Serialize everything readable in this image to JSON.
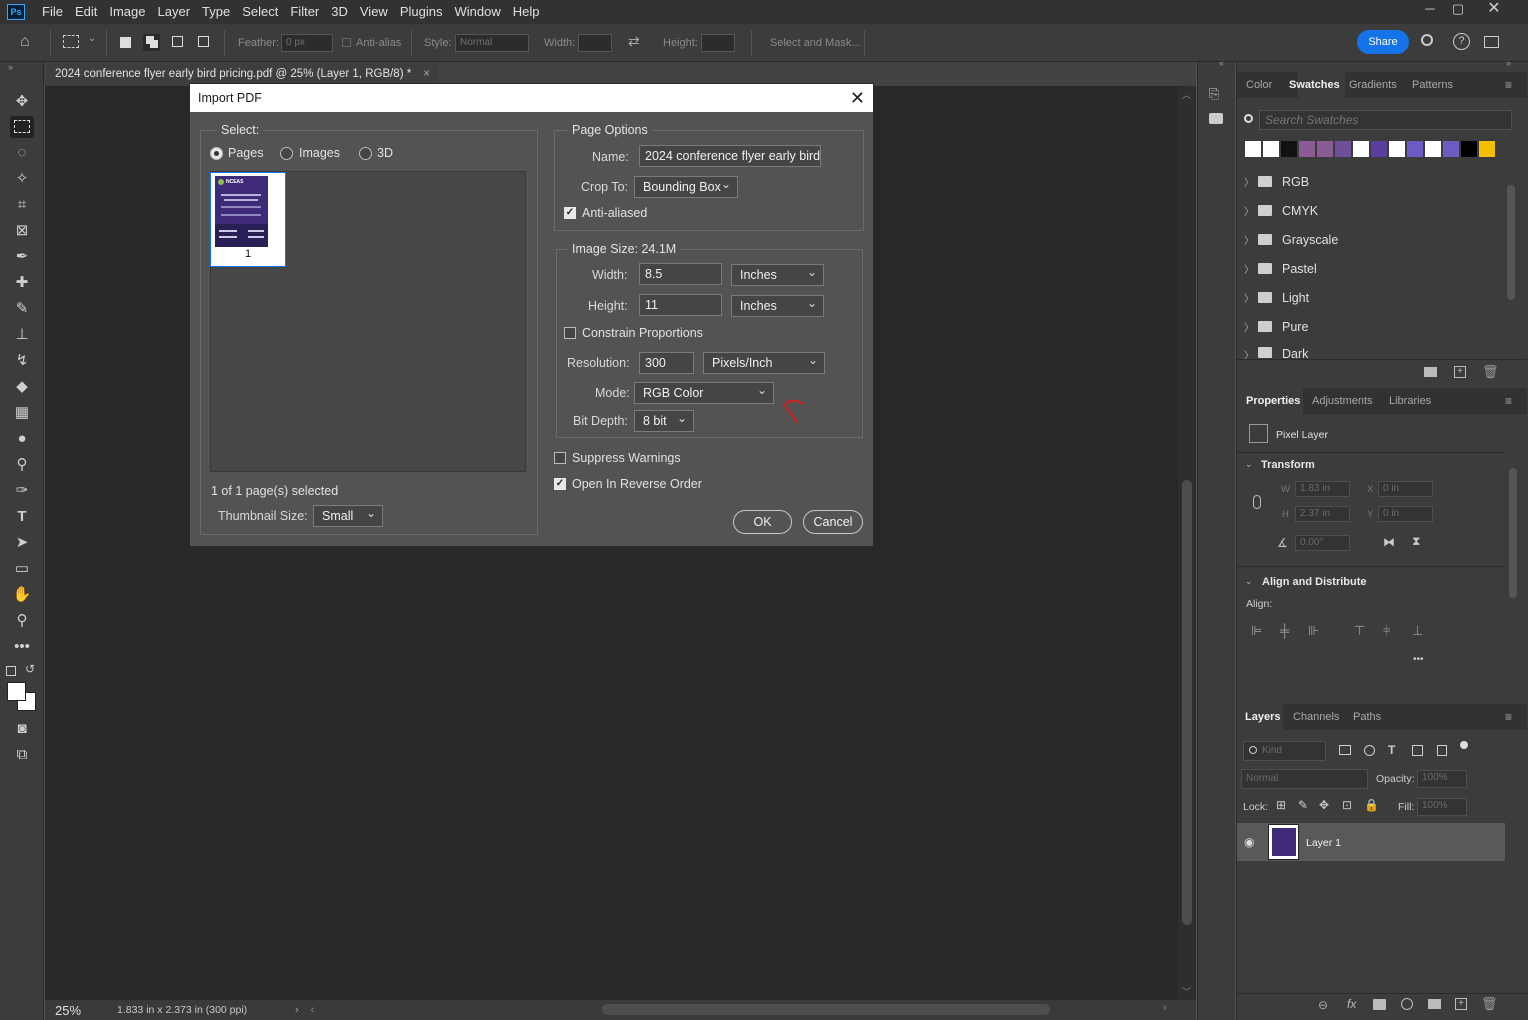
{
  "app": {
    "logo": "Ps"
  },
  "menu": [
    "File",
    "Edit",
    "Image",
    "Layer",
    "Type",
    "Select",
    "Filter",
    "3D",
    "View",
    "Plugins",
    "Window",
    "Help"
  ],
  "options": {
    "feather_label": "Feather:",
    "feather_value": "0 px",
    "antialias_label": "Anti-alias",
    "style_label": "Style:",
    "style_value": "Normal",
    "width_label": "Width:",
    "height_label": "Height:",
    "select_mask": "Select and Mask...",
    "share": "Share"
  },
  "document": {
    "tab_title": "2024 conference flyer early bird pricing.pdf @ 25% (Layer 1, RGB/8) *",
    "close": "×"
  },
  "status": {
    "zoom": "25%",
    "info": "1.833 in x 2.373 in (300 ppi)"
  },
  "swatches_panel": {
    "tabs": [
      "Color",
      "Swatches",
      "Gradients",
      "Patterns"
    ],
    "search_placeholder": "Search Swatches",
    "colors": [
      "#ffffff",
      "#ffffff",
      "#111111",
      "#8b5b95",
      "#8b5b95",
      "#6f4f9a",
      "#ffffff",
      "#5a3f9e",
      "#ffffff",
      "#6d5bc4",
      "#ffffff",
      "#6d5bc4",
      "#000000",
      "#f2c000"
    ],
    "folders": [
      "RGB",
      "CMYK",
      "Grayscale",
      "Pastel",
      "Light",
      "Pure",
      "Dark"
    ]
  },
  "properties_panel": {
    "tabs": [
      "Properties",
      "Adjustments",
      "Libraries"
    ],
    "kind": "Pixel Layer",
    "transform_title": "Transform",
    "w_label": "W",
    "w_value": "1.83 in",
    "h_label": "H",
    "h_value": "2.37 in",
    "x_label": "X",
    "x_value": "0 in",
    "y_label": "Y",
    "y_value": "0 in",
    "angle_value": "0.00°",
    "align_title": "Align and Distribute",
    "align_label": "Align:",
    "more": "•••"
  },
  "layers_panel": {
    "tabs": [
      "Layers",
      "Channels",
      "Paths"
    ],
    "kind_placeholder": "Kind",
    "blend": "Normal",
    "opacity_label": "Opacity:",
    "opacity_value": "100%",
    "lock_label": "Lock:",
    "fill_label": "Fill:",
    "fill_value": "100%",
    "layer_name": "Layer 1"
  },
  "dialog": {
    "title": "Import PDF",
    "select_label": "Select:",
    "radio_pages": "Pages",
    "radio_images": "Images",
    "radio_3d": "3D",
    "thumb_page": "1",
    "thumb_title": "NCEAS",
    "selected_text": "1 of 1 page(s) selected",
    "thumb_size_label": "Thumbnail Size:",
    "thumb_size_value": "Small",
    "page_options_label": "Page Options",
    "name_label": "Name:",
    "name_value": "2024 conference flyer early bird",
    "crop_label": "Crop To:",
    "crop_value": "Bounding Box",
    "antialiased_label": "Anti-aliased",
    "image_size_label": "Image Size: 24.1M",
    "width_label": "Width:",
    "width_value": "8.5",
    "width_unit": "Inches",
    "height_label": "Height:",
    "height_value": "11",
    "height_unit": "Inches",
    "constrain_label": "Constrain Proportions",
    "resolution_label": "Resolution:",
    "resolution_value": "300",
    "resolution_unit": "Pixels/Inch",
    "mode_label": "Mode:",
    "mode_value": "RGB Color",
    "bitdepth_label": "Bit Depth:",
    "bitdepth_value": "8 bit",
    "suppress_label": "Suppress Warnings",
    "reverse_label": "Open In Reverse Order",
    "ok": "OK",
    "cancel": "Cancel"
  }
}
